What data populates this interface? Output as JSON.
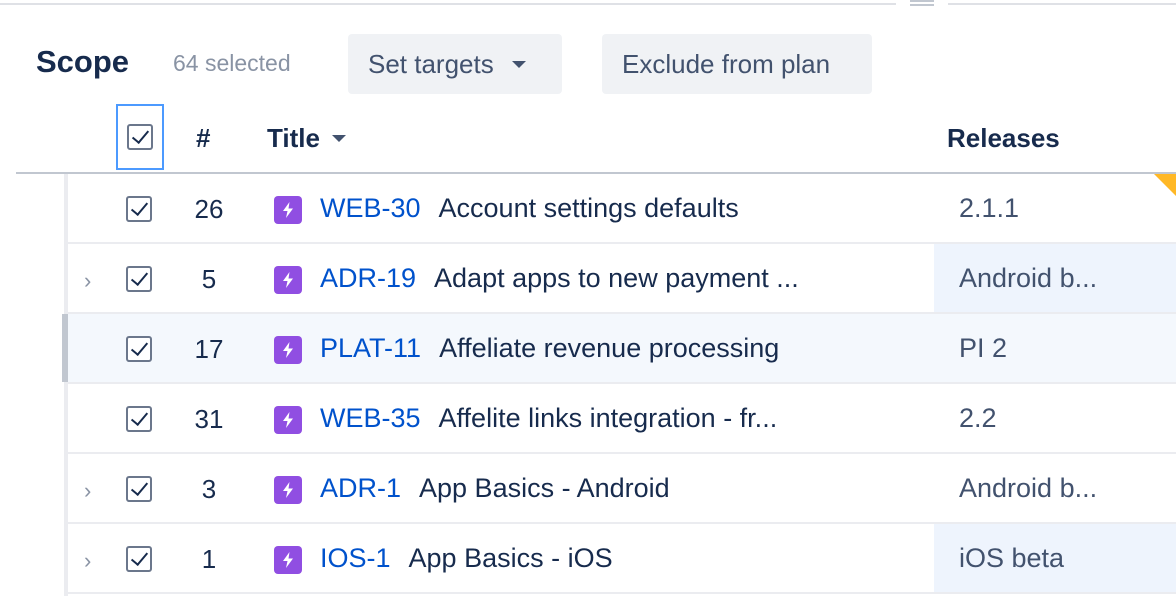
{
  "header": {
    "title": "Scope",
    "selected_count": "64 selected",
    "set_targets_label": "Set targets",
    "exclude_label": "Exclude from plan"
  },
  "columns": {
    "number": "#",
    "title": "Title",
    "releases": "Releases"
  },
  "colors": {
    "epic_icon": "#904ee2",
    "issue_key": "#0052cc",
    "focus_border": "#4c9aff",
    "warning_flag": "#ffab00"
  },
  "icons": {
    "expander": "chevron-right-icon",
    "epic": "epic-lightning-icon",
    "dropdown": "caret-down-icon",
    "checkbox": "checkbox-checked-icon"
  },
  "rows": [
    {
      "num": "26",
      "key": "WEB-30",
      "summary": "Account settings defaults",
      "release": "2.1.1",
      "expandable": false,
      "checked": true
    },
    {
      "num": "5",
      "key": "ADR-19",
      "summary": "Adapt apps to new payment ...",
      "release": "Android b...",
      "expandable": true,
      "checked": true
    },
    {
      "num": "17",
      "key": "PLAT-11",
      "summary": "Affeliate revenue processing",
      "release": "PI 2",
      "expandable": false,
      "checked": true
    },
    {
      "num": "31",
      "key": "WEB-35",
      "summary": "Affelite links integration - fr...",
      "release": "2.2",
      "expandable": false,
      "checked": true
    },
    {
      "num": "3",
      "key": "ADR-1",
      "summary": "App Basics - Android",
      "release": "Android b...",
      "expandable": true,
      "checked": true
    },
    {
      "num": "1",
      "key": "IOS-1",
      "summary": "App Basics - iOS",
      "release": "iOS beta",
      "expandable": true,
      "checked": true
    }
  ]
}
